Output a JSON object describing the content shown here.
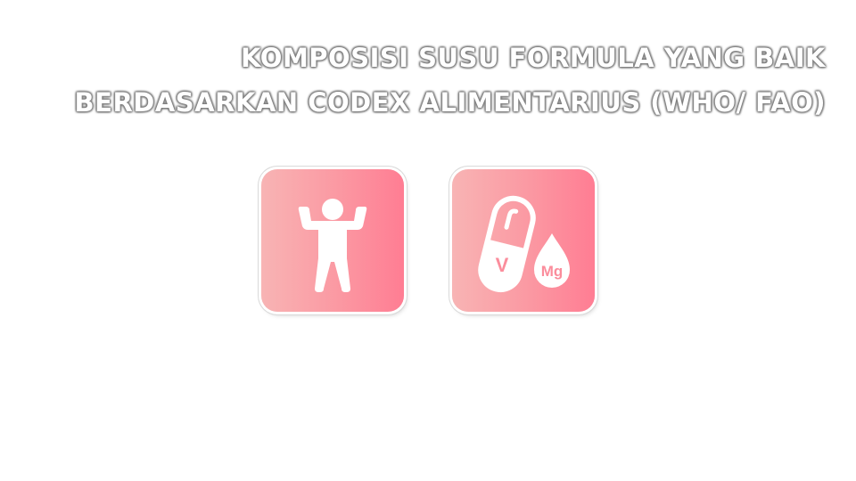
{
  "title": {
    "line1": "KOMPOSISI SUSU FORMULA YANG BAIK",
    "line2": "BERDASARKAN CODEX ALIMENTARIUS (WHO/ FAO)"
  },
  "tiles": [
    {
      "icon": "strong-person-icon"
    },
    {
      "icon": "vitamin-capsule-mineral-drop-icon",
      "capsule_label": "V",
      "drop_label": "Mg"
    }
  ],
  "colors": {
    "tile_gradient_start": "#f8b4b4",
    "tile_gradient_end": "#ff7d93",
    "icon": "#ffffff"
  }
}
